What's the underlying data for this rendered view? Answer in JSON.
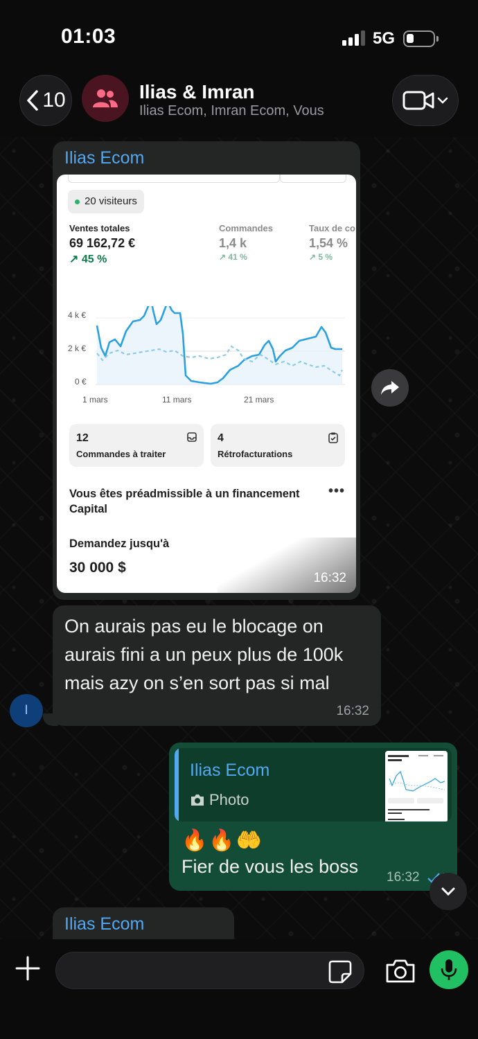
{
  "status_bar": {
    "time": "01:03",
    "network": "5G"
  },
  "header": {
    "back_count": "10",
    "group_name": "Ilias & Imran",
    "members": "Ilias Ecom, Imran Ecom, Vous"
  },
  "messages": {
    "image_message": {
      "sender": "Ilias Ecom",
      "time": "16:32",
      "screenshot": {
        "visitors": "20 visiteurs",
        "metrics": [
          {
            "label": "Ventes totales",
            "value": "69 162,72 €",
            "change": "↗ 45 %"
          },
          {
            "label": "Commandes",
            "value": "1,4 k",
            "change": "↗ 41 %"
          },
          {
            "label": "Taux de co",
            "value": "1,54 %",
            "change": "↗ 5 %"
          }
        ],
        "chart": {
          "y_ticks": [
            "4 k €",
            "2 k €",
            "0 €"
          ],
          "x_ticks": [
            "1 mars",
            "11 mars",
            "21 mars"
          ]
        },
        "cards": [
          {
            "number": "12",
            "caption": "Commandes à traiter"
          },
          {
            "number": "4",
            "caption": "Rétrofacturations"
          }
        ],
        "financing_title": "Vous êtes préadmissible à un financement Capital",
        "more": "•••",
        "ask_label": "Demandez jusqu'à",
        "amount": "30 000 $"
      }
    },
    "text_message": {
      "body": "On aurais  pas eu le blocage on aurais fini a un peux plus de 100k mais azy on s’en sort pas si mal",
      "time": "16:32",
      "avatar_initial": "I"
    },
    "reply_message": {
      "quoted_sender": "Ilias Ecom",
      "quoted_type": "Photo",
      "emojis": "🔥🔥🤲",
      "text": "Fier de vous les boss",
      "time": "16:32"
    },
    "partial_message": {
      "sender": "Ilias Ecom"
    }
  },
  "input": {
    "value": "",
    "placeholder": ""
  },
  "colors": {
    "accent_green": "#21c063",
    "outgoing_bubble": "#144d37",
    "incoming_bubble": "#242626",
    "sender_blue": "#53a8f2"
  }
}
